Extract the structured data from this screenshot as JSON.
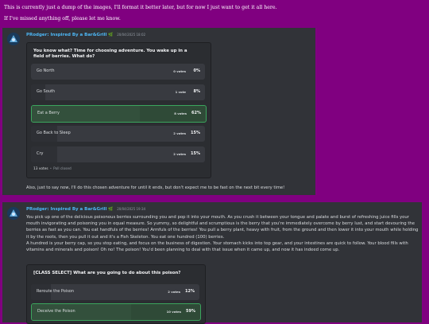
{
  "intro": {
    "line1": "This is currently just a dump of the images, I'll format it better later, but for now I just want to get it all here.",
    "line2": "If I've missed anything off, please let me know."
  },
  "message1": {
    "author": "PRodger: Inspired By a Bar&Grill",
    "timestamp": "20/04/2025 18:02",
    "poll": {
      "question": "You know what? Time for choosing adventure. You wake up in a field of berries. What do?",
      "options": [
        {
          "label": "Go North",
          "votes": "0 votes",
          "percent": "0%",
          "fraction": 0.0,
          "selected": false
        },
        {
          "label": "Go South",
          "votes": "1 vote",
          "percent": "8%",
          "fraction": 0.08,
          "selected": false
        },
        {
          "label": "Eat a Berry",
          "votes": "8 votes",
          "percent": "62%",
          "fraction": 0.62,
          "selected": true
        },
        {
          "label": "Go Back to Sleep",
          "votes": "2 votes",
          "percent": "15%",
          "fraction": 0.15,
          "selected": false
        },
        {
          "label": "Cry",
          "votes": "2 votes",
          "percent": "15%",
          "fraction": 0.15,
          "selected": false
        }
      ],
      "total_votes": "13 votes",
      "status": "Poll closed"
    },
    "followup": "Also, just to say now, I'll do this chosen adventure for until it ends, but don't expect me to be fast on the next bit every time!"
  },
  "message2": {
    "author": "PRodger: Inspired By a Bar&Grill",
    "timestamp": "20/04/2025 19:34",
    "paragraph1": "You pick up one of the delicious poisonous berries surrounding you and pop it into your mouth. As you crush it between your tongue and palate and burst of refreshing juice fills your mouth invigorating and poisoning you in equal measure. So yummy, so delightful and scrumptious is the berry that you're immediately overcome by berry lust, and start devouring the berries as fast as you can. You eat handfuls of the berries! Armfuls of the berries! You pull a berry plant, heavy with fruit, from the ground and then lower it into your mouth while holding it by the roots, then you pull it out and it's a Fish Skeleton. You eat one hundred (100) berries.",
    "paragraph2": "A hundred is your berry cap, so you stop eating, and focus on the business of digestion. Your stomach kicks into top gear, and your intestines are quick to follow. Your blood fills with vitamins and minerals and poison! Oh no! The poison! You'd been planning to deal with that issue when it came up, and now it has indeed come up.",
    "poll": {
      "question": "[CLASS SELECT] What are you going to do about this poison?",
      "options": [
        {
          "label": "Reroute the Poison",
          "votes": "2 votes",
          "percent": "12%",
          "fraction": 0.12,
          "selected": false
        },
        {
          "label": "Deceive the Poison",
          "votes": "10 votes",
          "percent": "59%",
          "fraction": 0.59,
          "selected": true
        }
      ]
    }
  },
  "colors": {
    "page_background": "#800080",
    "message_background": "#313338",
    "author_color": "#4db7f5",
    "selected_border": "#3ba55d"
  },
  "icons": {
    "avatar": "avatar-icon",
    "badge": "leaf-icon"
  }
}
